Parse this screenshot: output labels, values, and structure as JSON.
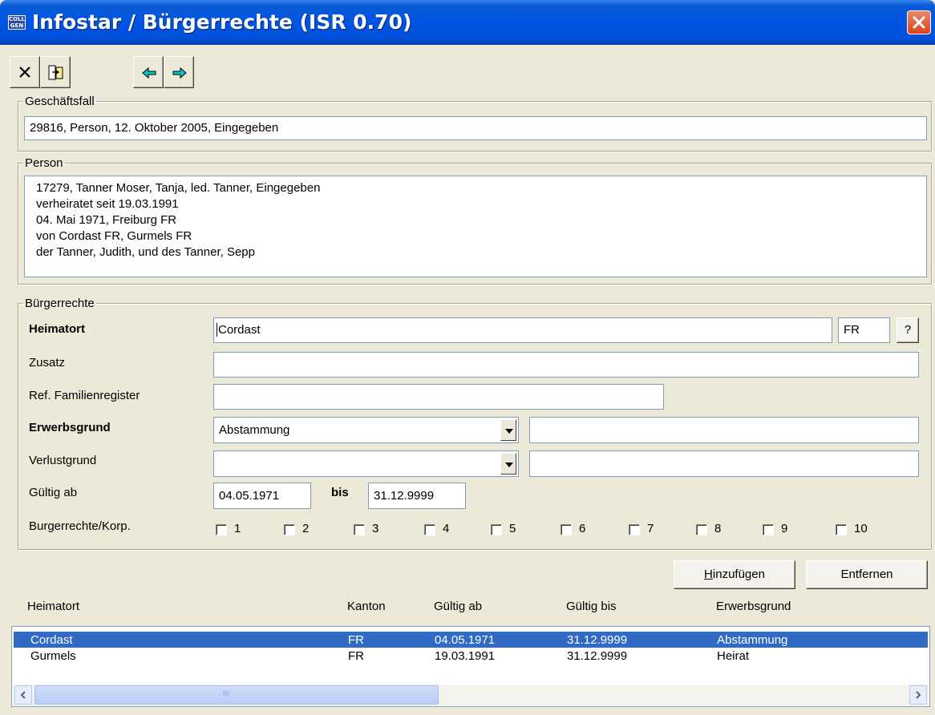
{
  "window": {
    "title": "Infostar / Bürgerrechte (ISR 0.70)",
    "app_icon_text": "COLL GEN"
  },
  "toolbar": {
    "icons": [
      "close-x-icon",
      "exit-door-icon",
      "arrow-left-icon",
      "arrow-right-icon"
    ]
  },
  "geschaeftsfall": {
    "legend": "Geschäftsfall",
    "value": "29816, Person, 12. Oktober 2005, Eingegeben"
  },
  "person": {
    "legend": "Person",
    "lines": [
      "17279, Tanner Moser, Tanja, led. Tanner, Eingegeben",
      "verheiratet seit 19.03.1991",
      "04. Mai 1971, Freiburg FR",
      "von Cordast FR, Gurmels FR",
      "der Tanner, Judith, und des Tanner, Sepp"
    ]
  },
  "buergerrechte": {
    "legend": "Bürgerrechte",
    "heimatort_label": "Heimatort",
    "heimatort_value": "Cordast",
    "kanton_value": "FR",
    "help_button": "?",
    "zusatz_label": "Zusatz",
    "zusatz_value": "",
    "ref_label": "Ref. Familienregister",
    "ref_value": "",
    "erwerbsgrund_label": "Erwerbsgrund",
    "erwerbsgrund_value": "Abstammung",
    "erwerbsgrund_extra": "",
    "verlustgrund_label": "Verlustgrund",
    "verlustgrund_value": "",
    "verlustgrund_extra": "",
    "gueltig_label": "Gültig ab",
    "gueltig_ab": "04.05.1971",
    "bis_label": "bis",
    "gueltig_bis": "31.12.9999",
    "korp_label": "Burgerrechte/Korp.",
    "korp_checkboxes": [
      "1",
      "2",
      "3",
      "4",
      "5",
      "6",
      "7",
      "8",
      "9",
      "10"
    ]
  },
  "actions": {
    "add_label": "Hinzufügen",
    "add_mnemonic": "H",
    "add_rest": "inzufügen",
    "remove_label": "Entfernen"
  },
  "list": {
    "headers": [
      "Heimatort",
      "Kanton",
      "Gültig ab",
      "Gültig bis",
      "Erwerbsgrund"
    ],
    "rows": [
      {
        "heimatort": "Cordast",
        "kanton": "FR",
        "gueltig_ab": "04.05.1971",
        "gueltig_bis": "31.12.9999",
        "erwerbsgrund": "Abstammung",
        "selected": true
      },
      {
        "heimatort": "Gurmels",
        "kanton": "FR",
        "gueltig_ab": "19.03.1991",
        "gueltig_bis": "31.12.9999",
        "erwerbsgrund": "Heirat",
        "selected": false
      }
    ],
    "scroll_thumb_grip": "III"
  },
  "colors": {
    "title_bar": "#0054e3",
    "selection": "#316ac5",
    "dialog_bg": "#ece9d8",
    "close_button": "#d9441c"
  }
}
